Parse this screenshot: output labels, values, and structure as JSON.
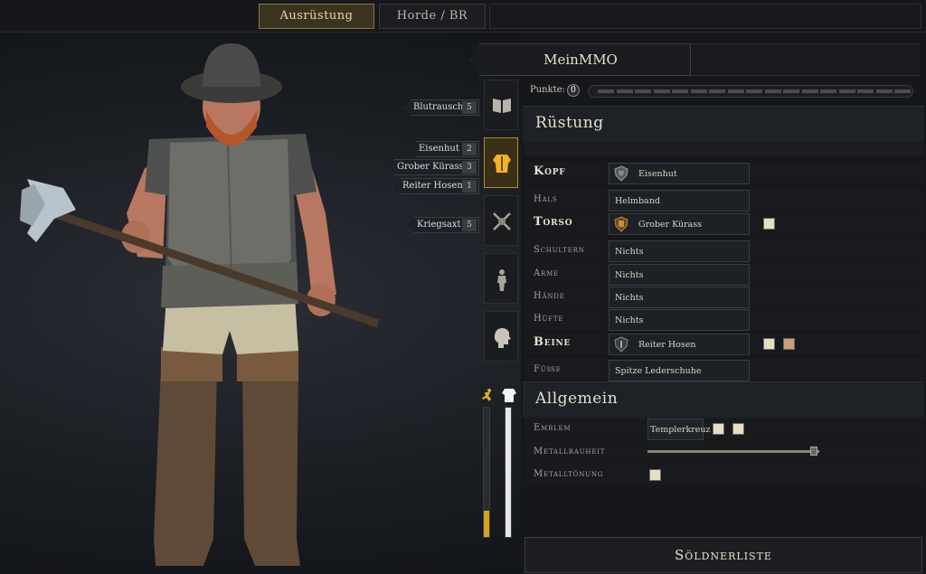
{
  "tabs": [
    {
      "label": "Ausrüstung",
      "active": true
    },
    {
      "label": "Horde / BR",
      "active": false
    },
    {
      "label": "",
      "active": false
    }
  ],
  "loadout_tags": [
    {
      "label": "Blutrausch",
      "count": "5"
    },
    {
      "label": "Eisenhut",
      "count": "2"
    },
    {
      "label": "Grober Kürass",
      "count": "3"
    },
    {
      "label": "Reiter Hosen",
      "count": "1"
    },
    {
      "label": "Kriegsaxt",
      "count": "5"
    }
  ],
  "categories": [
    {
      "icon": "book-icon"
    },
    {
      "icon": "armor-icon",
      "active": true
    },
    {
      "icon": "crossed-weapons-icon"
    },
    {
      "icon": "body-icon"
    },
    {
      "icon": "head-icon"
    }
  ],
  "stat_icons": [
    "sprint-icon",
    "armor-stat-icon"
  ],
  "bars": {
    "stamina_level": 0.2,
    "armor_level": 1.0,
    "stamina_color": "#d4a51a",
    "armor_color": "#e8e8e8"
  },
  "profile": {
    "name": "MeinMMO"
  },
  "punkte": {
    "label": "Punkte:",
    "value": "0"
  },
  "ruestung": {
    "title": "Rüstung",
    "rows": [
      {
        "label": "Kopf",
        "strong": true,
        "item": "Eisenhut",
        "icon": "iron-helmet-icon",
        "swatches": []
      },
      {
        "label": "Hals",
        "strong": false,
        "item": "Helmband",
        "icon": "",
        "swatches": []
      },
      {
        "label": "Torso",
        "strong": true,
        "item": "Grober Kürass",
        "icon": "cuirass-icon",
        "swatches": [
          "#e6dfc4"
        ]
      },
      {
        "label": "Schultern",
        "strong": false,
        "item": "Nichts",
        "icon": "",
        "swatches": []
      },
      {
        "label": "Arme",
        "strong": false,
        "item": "Nichts",
        "icon": "",
        "swatches": []
      },
      {
        "label": "Hände",
        "strong": false,
        "item": "Nichts",
        "icon": "",
        "swatches": []
      },
      {
        "label": "Hüfte",
        "strong": false,
        "item": "Nichts",
        "icon": "",
        "swatches": []
      },
      {
        "label": "Beine",
        "strong": true,
        "item": "Reiter Hosen",
        "icon": "leg-armor-icon",
        "swatches": [
          "#e6dfc4",
          "#c9a07a"
        ]
      },
      {
        "label": "Füße",
        "strong": false,
        "item": "Spitze Lederschuhe",
        "icon": "",
        "swatches": []
      }
    ]
  },
  "allgemein": {
    "title": "Allgemein",
    "emblem_label": "Emblem",
    "emblem_value": "Templerkreuz",
    "emblem_swatches": [
      "#e6dfc4",
      "#e6dfc4"
    ],
    "metallrauheit_label": "Metallrauheit",
    "metallrauheit_value": 0.97,
    "metalltoenung_label": "Metalltönung",
    "metalltoenung_swatch": "#e6dfc4"
  },
  "footer_button": "Söldnerliste",
  "colors": {
    "accent_gold": "#b08a2a",
    "panel_bg": "#15171b"
  }
}
